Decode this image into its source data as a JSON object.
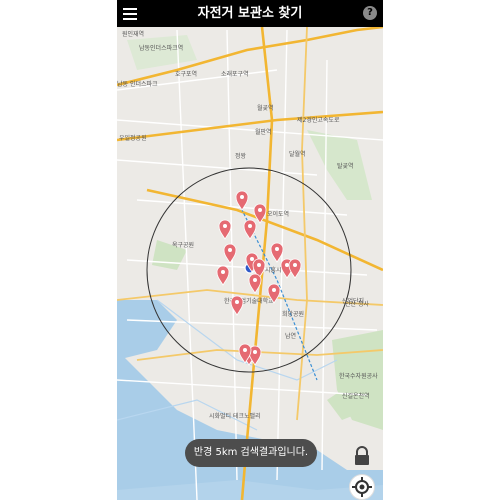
{
  "header": {
    "title": "자전거 보관소 찾기",
    "help_symbol": "?",
    "menu_icon": "hamburger-icon",
    "background": "#000000"
  },
  "map": {
    "search_radius": "5km",
    "pin_color": "#e56a72",
    "place_labels": [
      "원인재역",
      "남동인더스파크역",
      "호구포역",
      "남동 인더스파크",
      "소래포구역",
      "월곶역",
      "제2경인고속도로",
      "우일정공원",
      "달월역",
      "월판역",
      "정왕",
      "탈곶역",
      "오이도역",
      "옥구공원",
      "한국산업기술대학교",
      "시흥시청",
      "희망공원",
      "남연",
      "산업단지",
      "안산 청사",
      "시화멀티 테크노밸리",
      "한국수자원공사",
      "신길온천역"
    ]
  },
  "toast": {
    "message": "반경 5km 검색결과입니다."
  },
  "controls": {
    "lock_icon": "lock-icon",
    "locate_icon": "crosshair-icon"
  }
}
